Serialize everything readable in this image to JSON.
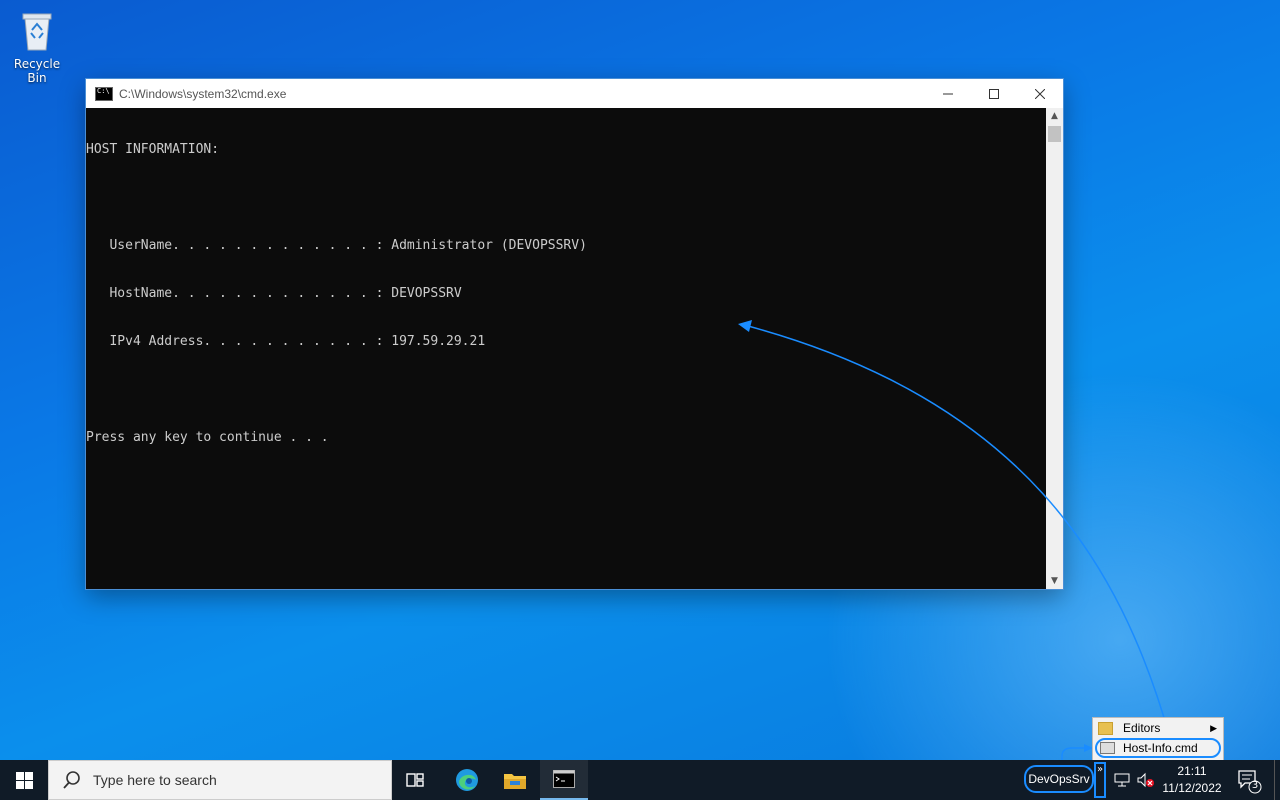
{
  "desktop": {
    "recycle_bin_label": "Recycle Bin"
  },
  "window": {
    "title": "C:\\Windows\\system32\\cmd.exe",
    "console_lines": [
      "HOST INFORMATION:",
      "",
      "   UserName. . . . . . . . . . . . . : Administrator (DEVOPSSRV)",
      "   HostName. . . . . . . . . . . . . : DEVOPSSRV",
      "   IPv4 Address. . . . . . . . . . . : 197.59.29.21",
      "",
      "Press any key to continue . . ."
    ]
  },
  "popup_menu": {
    "items": [
      {
        "label": "Editors",
        "has_submenu": true
      },
      {
        "label": "Host-Info.cmd",
        "highlighted": true
      }
    ]
  },
  "taskbar": {
    "search_placeholder": "Type here to search",
    "toolbar_label": "DevOpsSrv",
    "clock_time": "21:11",
    "clock_date": "11/12/2022",
    "notification_count": "3",
    "pinned": [
      "task-view",
      "edge",
      "file-explorer",
      "command-prompt"
    ]
  },
  "colors": {
    "annotation": "#1a8cff",
    "console_bg": "#0c0c0c",
    "console_fg": "#cccccc",
    "taskbar_bg": "#101b27"
  }
}
